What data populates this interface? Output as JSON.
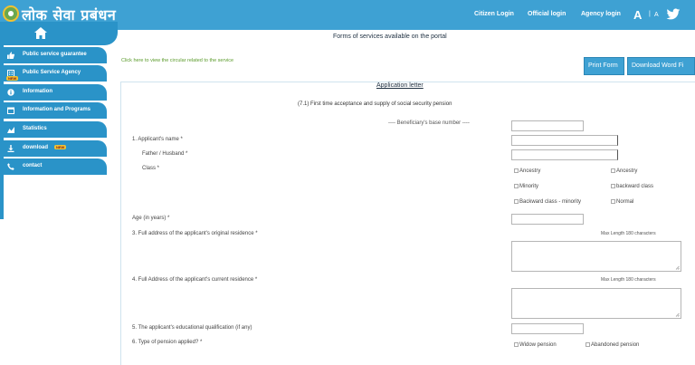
{
  "header": {
    "brand": "लोक सेवा प्रबंधन",
    "nav": [
      "Citizen Login",
      "Official login",
      "Agency login"
    ],
    "font_large": "A",
    "font_sep": "|",
    "font_small": "A"
  },
  "sidebar": {
    "items": [
      {
        "label": "Public service guarantee",
        "icon": "thumbs-up-icon",
        "badge": ""
      },
      {
        "label": "Public Service Agency",
        "icon": "building-icon",
        "badge": "NEW"
      },
      {
        "label": "Information",
        "icon": "info-icon",
        "badge": ""
      },
      {
        "label": "Information and Programs",
        "icon": "calendar-icon",
        "badge": ""
      },
      {
        "label": "Statistics",
        "icon": "chart-icon",
        "badge": ""
      },
      {
        "label": "download",
        "icon": "download-icon",
        "badge": "NEW"
      },
      {
        "label": "contact",
        "icon": "phone-icon",
        "badge": ""
      }
    ]
  },
  "main": {
    "title": "Forms of services available on the portal",
    "circular_link": "Click here to view the circular related to the service",
    "print_button": "Print Form",
    "download_button": "Download Word Fi"
  },
  "form": {
    "heading": "Application letter",
    "subheading": "(7.1) First time acceptance and supply of social security pension",
    "beneficiary_label": "---- Beneficiary's base number ----",
    "labels": {
      "name": "1. Applicant's name *",
      "father": "Father / Husband *",
      "class": "Class *",
      "age": "Age (in years) *",
      "original_address": "3. Full address of the applicant's original residence *",
      "current_address": "4. Full Address of the applicant's current residence *",
      "education": "5. The applicant's educational qualification (if any)",
      "pension_type": "6. Type of pension applied? *"
    },
    "class_options": [
      "Ancestry",
      "Ancestry",
      "Minority",
      "backward class",
      "Backward class - minority",
      "Normal"
    ],
    "max_length_note": "Max Length 180 characters",
    "pension_options": [
      "Widow pension",
      "Abandoned pension"
    ]
  }
}
